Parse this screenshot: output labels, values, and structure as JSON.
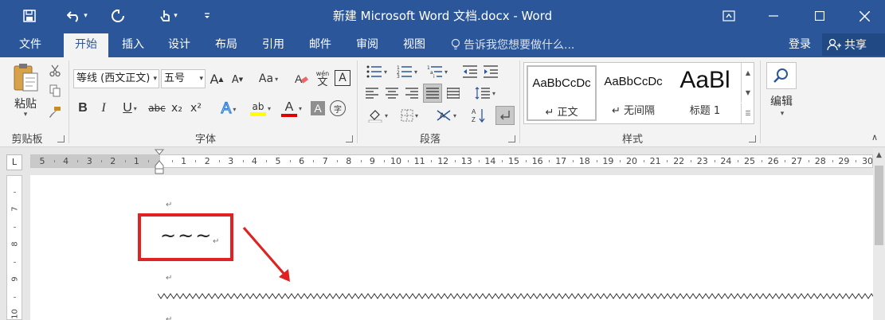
{
  "titlebar": {
    "title": "新建 Microsoft Word 文档.docx - Word",
    "quick_access": [
      "save-icon",
      "undo-icon",
      "redo-icon",
      "touch-mode-icon",
      "customize-icon"
    ],
    "window_controls": [
      "ribbon-display-icon",
      "minimize-icon",
      "maximize-icon",
      "close-icon"
    ]
  },
  "tabs": {
    "items": [
      {
        "label": "文件"
      },
      {
        "label": "开始"
      },
      {
        "label": "插入"
      },
      {
        "label": "设计"
      },
      {
        "label": "布局"
      },
      {
        "label": "引用"
      },
      {
        "label": "邮件"
      },
      {
        "label": "审阅"
      },
      {
        "label": "视图"
      }
    ],
    "active": "开始",
    "tell_me": "告诉我您想要做什么...",
    "login": "登录",
    "share": "共享"
  },
  "ribbon": {
    "clipboard": {
      "label": "剪贴板",
      "paste": "粘贴"
    },
    "font": {
      "label": "字体",
      "font_name": "等线 (西文正文)",
      "font_size": "五号",
      "bold": "B",
      "italic": "I",
      "underline": "U",
      "strikethrough": "abc",
      "subscript": "x₂",
      "superscript": "x²",
      "grow": "A",
      "shrink": "A",
      "case": "Aa",
      "phonetic": "wén",
      "phonetic_char": "文",
      "border_char": "A",
      "text_effects": "A",
      "highlight": "ab",
      "font_color": "A",
      "shading": "A",
      "enclose": "字",
      "font_color_hex": "#e00000",
      "highlight_hex": "#ffff00"
    },
    "paragraph": {
      "label": "段落"
    },
    "styles": {
      "label": "样式",
      "items": [
        {
          "sample": "AaBbCcDc",
          "name": "↵ 正文"
        },
        {
          "sample": "AaBbCcDc",
          "name": "↵ 无间隔"
        },
        {
          "sample": "AaBl",
          "name": "标题 1"
        }
      ]
    },
    "editing": {
      "label": "编辑"
    }
  },
  "ruler": {
    "corner": "L",
    "left_numbers": [
      "5",
      "4",
      "3",
      "2",
      "1"
    ],
    "right_numbers": [
      "1",
      "2",
      "3",
      "4",
      "5",
      "6",
      "7",
      "8",
      "9",
      "10",
      "11",
      "12",
      "13",
      "14",
      "15",
      "16",
      "17",
      "18",
      "19",
      "20",
      "21",
      "22",
      "23",
      "24",
      "25",
      "26",
      "27",
      "28",
      "29",
      "30"
    ],
    "vertical_numbers": [
      "7",
      "8",
      "9",
      "10"
    ]
  },
  "document": {
    "tilde_text": "~~~",
    "paragraph_mark": "↵"
  }
}
